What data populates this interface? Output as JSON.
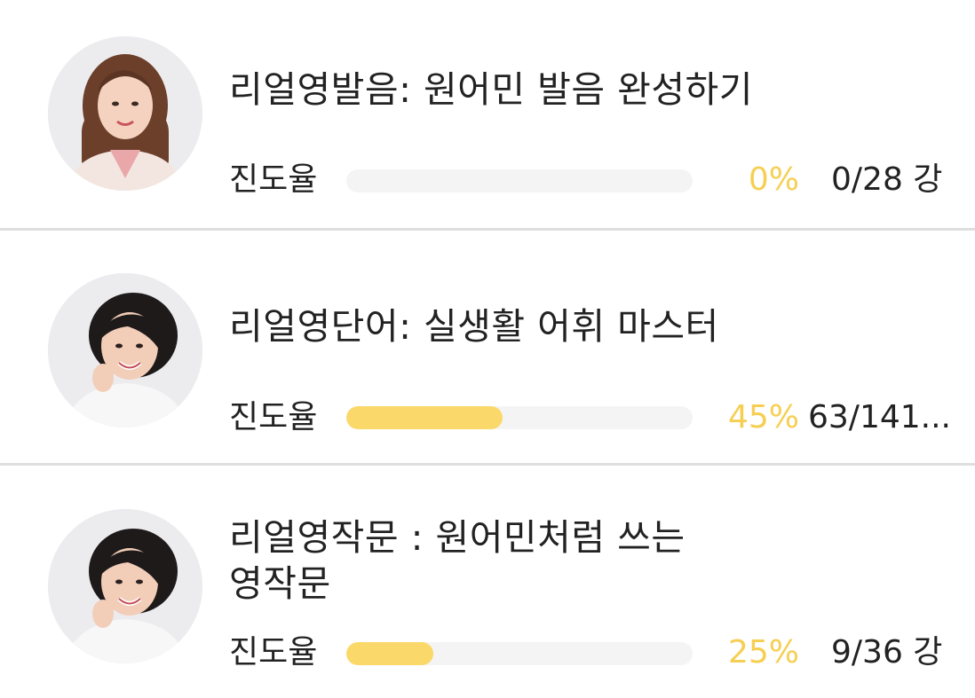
{
  "courses": [
    {
      "title": "리얼영발음: 원어민 발음 완성하기",
      "progress_label": "진도율",
      "progress_value": 0,
      "percent_text": "0%",
      "count_text": "0/28 강",
      "avatar_icon": "instructor-portrait-long-hair"
    },
    {
      "title": "리얼영단어: 실생활 어휘 마스터",
      "progress_label": "진도율",
      "progress_value": 0.45,
      "percent_text": "45%",
      "count_text": "63/141...",
      "avatar_icon": "instructor-portrait-short-hair"
    },
    {
      "title_line1": "리얼영작문 : 원어민처럼 쓰는",
      "title_line2": "영작문",
      "progress_label": "진도율",
      "progress_value": 0.25,
      "percent_text": "25%",
      "count_text": "9/36 강",
      "avatar_icon": "instructor-portrait-short-hair"
    }
  ],
  "colors": {
    "accent": "#f6cf52",
    "bar_fill": "#fbd86a",
    "track": "#f4f4f4",
    "divider": "#dedede",
    "text": "#222222"
  }
}
